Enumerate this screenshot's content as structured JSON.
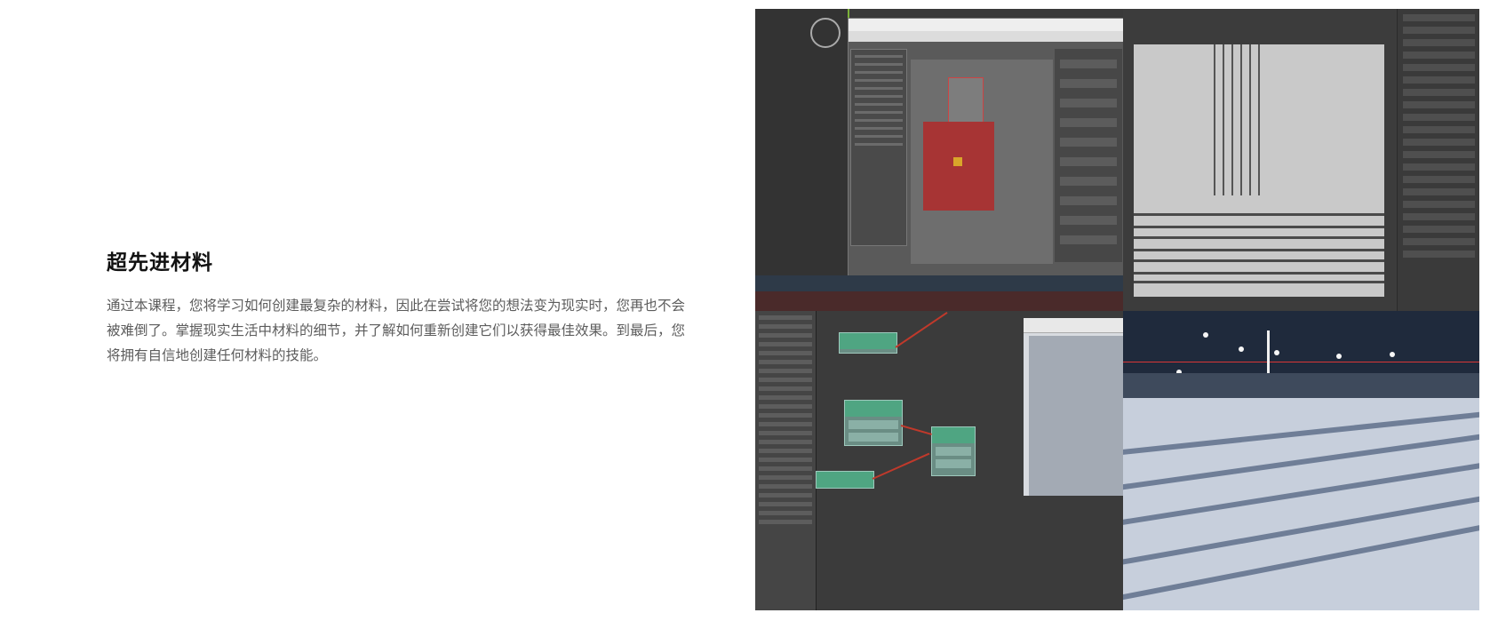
{
  "heading": "超先进材料",
  "description": "通过本课程，您将学习如何创建最复杂的材料，因此在尝试将您的想法变为现实时，您再也不会被难倒了。掌握现实生活中材料的细节，并了解如何重新创建它们以获得最佳效果。到最后，您将拥有自信地创建任何材料的技能。",
  "collage": {
    "panels": [
      "uv-editor-screenshot",
      "photoshop-screenshot",
      "slate-material-editor-screenshot",
      "snow-render-image"
    ]
  }
}
